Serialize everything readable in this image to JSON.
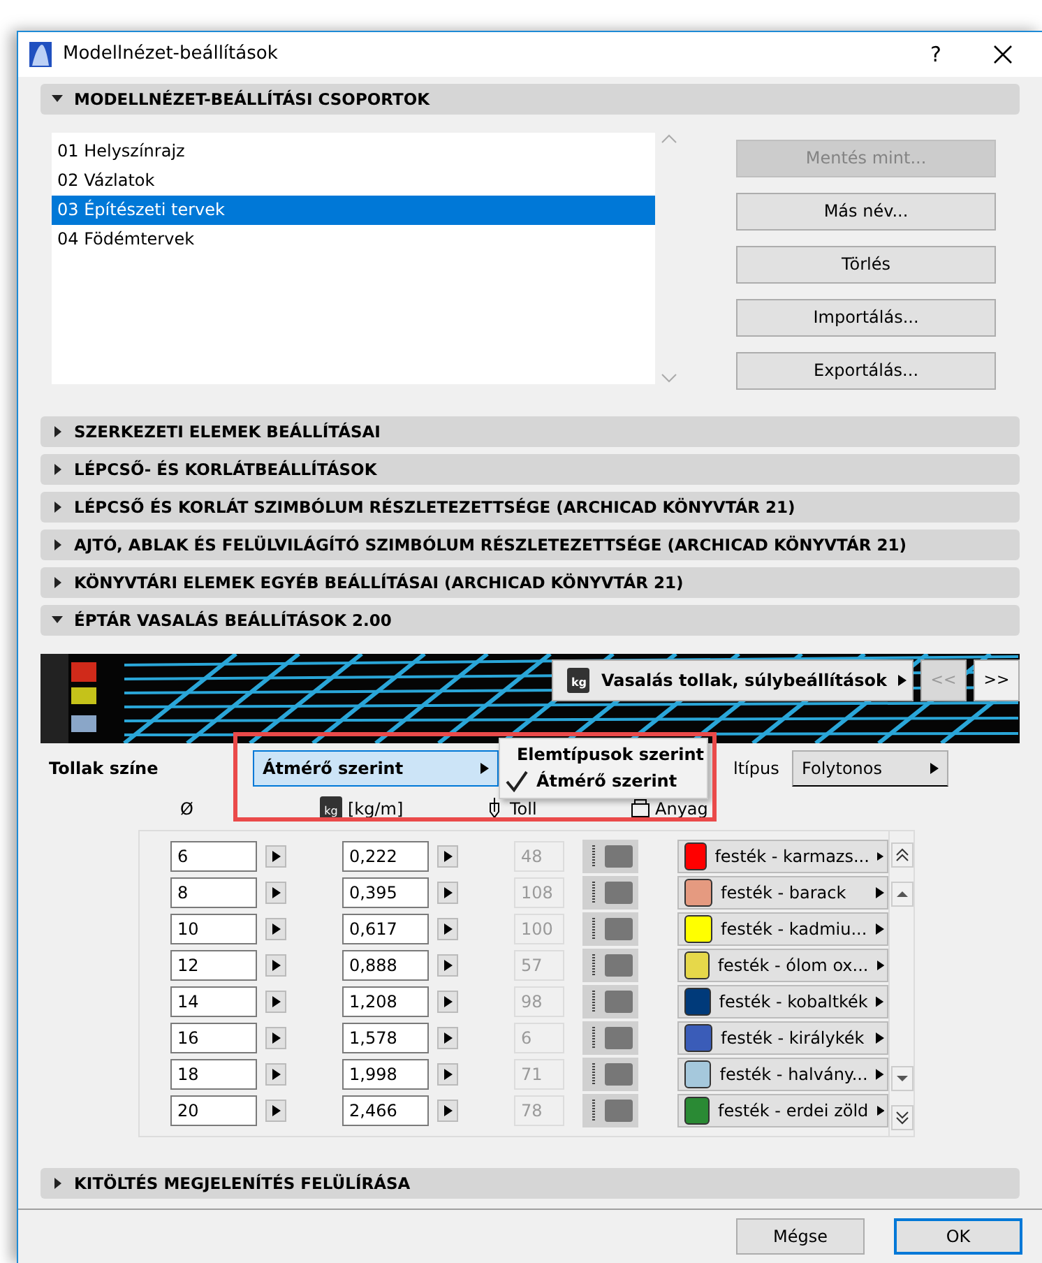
{
  "window": {
    "title": "Modellnézet-beállítások",
    "help": "?"
  },
  "sections": [
    {
      "kind": "groups",
      "title": "MODELLNÉZET-BEÁLLÍTÁSI CSOPORTOK",
      "expanded": true
    },
    {
      "kind": "plain",
      "title": "SZERKEZETI ELEMEK BEÁLLÍTÁSAI",
      "expanded": false
    },
    {
      "kind": "plain",
      "title": "LÉPCSŐ- ÉS KORLÁTBEÁLLÍTÁSOK",
      "expanded": false
    },
    {
      "kind": "plain",
      "title": "LÉPCSŐ ÉS KORLÁT SZIMBÓLUM RÉSZLETEZETTSÉGE (ARCHICAD KÖNYVTÁR 21)",
      "expanded": false
    },
    {
      "kind": "plain",
      "title": "AJTÓ, ABLAK ÉS FELÜLVILÁGÍTÓ SZIMBÓLUM RÉSZLETEZETTSÉGE (ARCHICAD KÖNYVTÁR 21)",
      "expanded": false
    },
    {
      "kind": "plain",
      "title": "KÖNYVTÁRI ELEMEK EGYÉB BEÁLLÍTÁSAI (ARCHICAD KÖNYVTÁR 21)",
      "expanded": false
    },
    {
      "kind": "rebar",
      "title": "ÉPTÁR VASALÁS BEÁLLÍTÁSOK 2.00",
      "expanded": true
    },
    {
      "kind": "plain",
      "title": "KITÖLTÉS MEGJELENÍTÉS FELÜLÍRÁSA",
      "expanded": false
    }
  ],
  "groups": {
    "items": [
      {
        "label": "01 Helyszínrajz",
        "selected": false
      },
      {
        "label": "02 Vázlatok",
        "selected": false
      },
      {
        "label": "03 Építészeti tervek",
        "selected": true
      },
      {
        "label": "04 Födémtervek",
        "selected": false
      }
    ],
    "buttons": [
      {
        "label": "Mentés mint...",
        "disabled": true
      },
      {
        "label": "Más név...",
        "disabled": false
      },
      {
        "label": "Törlés",
        "disabled": false
      },
      {
        "label": "Importálás...",
        "disabled": false
      },
      {
        "label": "Exportálás...",
        "disabled": false
      }
    ]
  },
  "rebar": {
    "banner_icon_text": "kg",
    "banner_button": "Vasalás tollak, súlybeállítások",
    "weight_icon_text": "kg",
    "prev": "<<",
    "next": ">>",
    "pen_color_label": "Tollak színe",
    "pen_color_value": "Átmérő szerint",
    "menu": [
      {
        "label": "Elemtípusok szerint",
        "checked": false
      },
      {
        "label": "Átmérő szerint",
        "checked": true
      }
    ],
    "line_type_label": "ltípus",
    "line_type_value": "Folytonos",
    "columns": [
      "Ø",
      "[kg/m]",
      "Toll",
      "Anyag"
    ],
    "rows": [
      {
        "diameter": "6",
        "weight": "0,222",
        "pen": "48",
        "material": "festék - karmazs...",
        "color": "#ff0000"
      },
      {
        "diameter": "8",
        "weight": "0,395",
        "pen": "108",
        "material": "festék - barack",
        "color": "#e59a80"
      },
      {
        "diameter": "10",
        "weight": "0,617",
        "pen": "100",
        "material": "festék - kadmiu...",
        "color": "#ffff00"
      },
      {
        "diameter": "12",
        "weight": "0,888",
        "pen": "57",
        "material": "festék - ólom ox...",
        "color": "#e6d84a"
      },
      {
        "diameter": "14",
        "weight": "1,208",
        "pen": "98",
        "material": "festék - kobaltkék",
        "color": "#003a7a"
      },
      {
        "diameter": "16",
        "weight": "1,578",
        "pen": "6",
        "material": "festék - királykék",
        "color": "#3a5cb8"
      },
      {
        "diameter": "18",
        "weight": "1,998",
        "pen": "71",
        "material": "festék - halvány...",
        "color": "#a5c8dc"
      },
      {
        "diameter": "20",
        "weight": "2,466",
        "pen": "78",
        "material": "festék - erdei zöld",
        "color": "#2a8a34"
      }
    ]
  },
  "footer": {
    "cancel": "Mégse",
    "ok": "OK"
  }
}
